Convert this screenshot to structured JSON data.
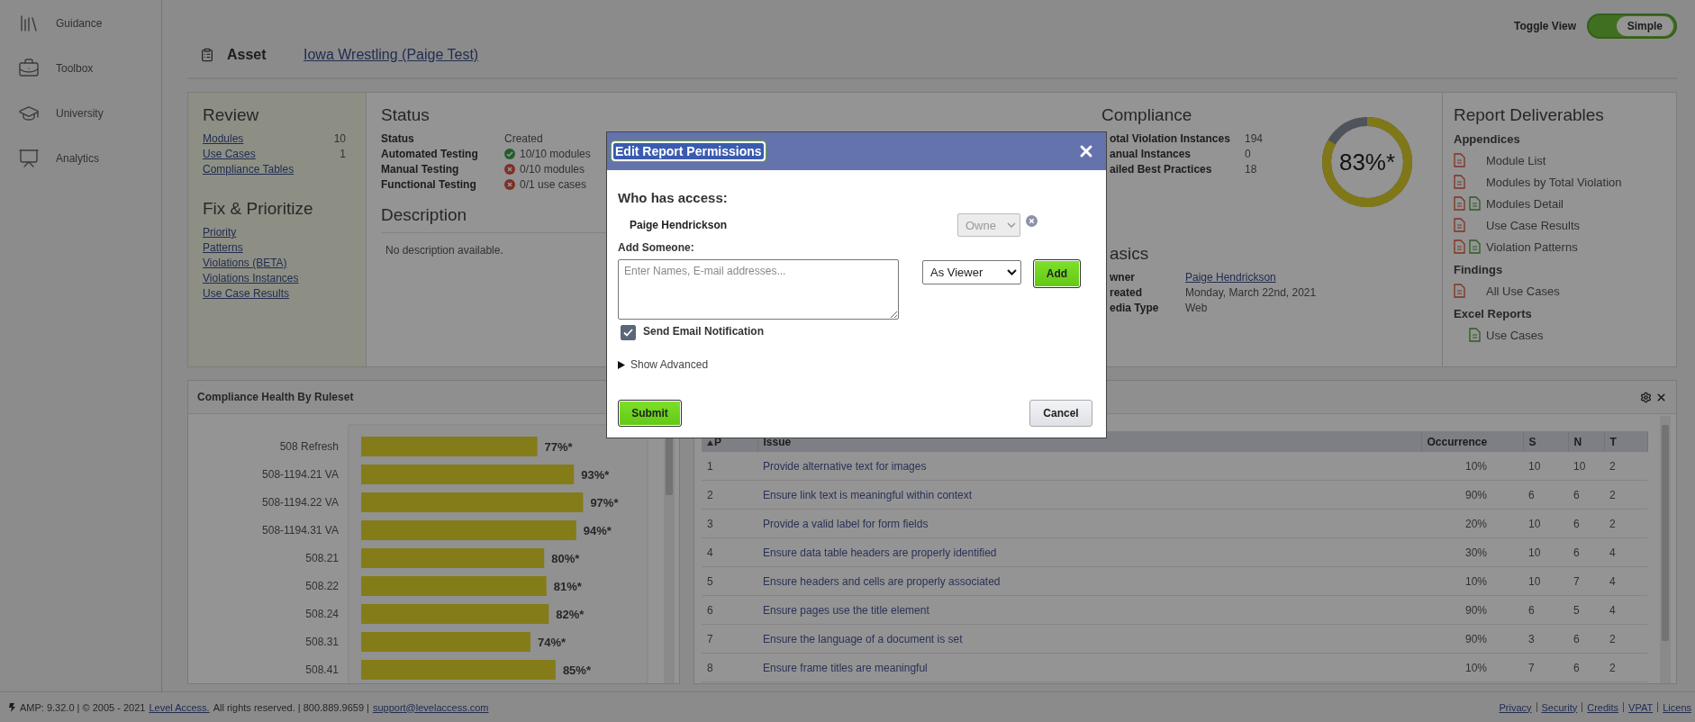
{
  "sidebar": {
    "items": [
      {
        "label": "Guidance"
      },
      {
        "label": "Toolbox"
      },
      {
        "label": "University"
      },
      {
        "label": "Analytics"
      }
    ]
  },
  "toggle_view": {
    "label": "Toggle View",
    "option": "Simple",
    "on": true
  },
  "asset": {
    "label": "Asset",
    "name": "Iowa Wrestling (Paige Test)"
  },
  "review": {
    "title": "Review",
    "links": [
      {
        "label": "Modules",
        "count": "10"
      },
      {
        "label": "Use Cases",
        "count": "1"
      },
      {
        "label": "Compliance Tables"
      }
    ]
  },
  "fix_prioritize": {
    "title": "Fix & Prioritize",
    "links": [
      "Priority",
      "Patterns",
      "Violations (BETA)",
      "Violations Instances",
      "Use Case Results"
    ]
  },
  "status": {
    "title": "Status",
    "rows": [
      {
        "label": "Status",
        "value": "Created",
        "kind": "plain"
      },
      {
        "label": "Automated Testing",
        "value": "10/10 modules",
        "kind": "pass"
      },
      {
        "label": "Manual Testing",
        "value": "0/10 modules",
        "kind": "fail"
      },
      {
        "label": "Functional Testing",
        "value": "0/1 use cases",
        "kind": "fail"
      }
    ]
  },
  "description": {
    "title": "Description",
    "text": "No description available."
  },
  "compliance": {
    "title": "Compliance",
    "rows": [
      {
        "label": "otal Violation Instances",
        "value": "194"
      },
      {
        "label": "anual Instances",
        "value": "0"
      },
      {
        "label": "ailed Best Practices",
        "value": "18"
      }
    ],
    "gauge": {
      "label": "83%*",
      "level": 0.83
    }
  },
  "basics": {
    "title": "asics",
    "rows": [
      {
        "label": "wner",
        "value": "Paige Hendrickson",
        "kind": "link"
      },
      {
        "label": "reated",
        "value": "Monday, March 22nd, 2021",
        "kind": "text"
      },
      {
        "label": "edia Type",
        "value": "Web",
        "kind": "text"
      }
    ]
  },
  "deliverables": {
    "title": "Report Deliverables",
    "groups": [
      {
        "title": "Appendices",
        "items": [
          {
            "label": "Module List",
            "pdf": true,
            "spreadsheet": false
          },
          {
            "label": "Modules by Total Violation",
            "pdf": true,
            "spreadsheet": false
          },
          {
            "label": "Modules Detail",
            "pdf": true,
            "spreadsheet": true
          },
          {
            "label": "Use Case Results",
            "pdf": true,
            "spreadsheet": false
          },
          {
            "label": "Violation Patterns",
            "pdf": true,
            "spreadsheet": true
          }
        ]
      },
      {
        "title": "Findings",
        "items": [
          {
            "label": "All Use Cases",
            "pdf": true,
            "spreadsheet": false
          }
        ]
      },
      {
        "title": "Excel Reports",
        "items": [
          {
            "label": "Use Cases",
            "pdf": false,
            "spreadsheet": true
          }
        ]
      }
    ]
  },
  "health": {
    "title": "Compliance Health By Ruleset",
    "chart_data": {
      "type": "bar",
      "orientation": "horizontal",
      "categories": [
        "508 Refresh",
        "508-1194.21 VA",
        "508-1194.22 VA",
        "508-1194.31 VA",
        "508.21",
        "508.22",
        "508.24",
        "508.31",
        "508.41"
      ],
      "values": [
        77,
        93,
        97,
        94,
        80,
        81,
        82,
        74,
        85
      ],
      "value_labels": [
        "77%*",
        "93%*",
        "97%*",
        "94%*",
        "80%*",
        "81%*",
        "82%*",
        "74%*",
        "85%*"
      ]
    }
  },
  "issues": {
    "columns": [
      {
        "label": "P",
        "sorted": true
      },
      {
        "label": "Issue",
        "sorted": false
      },
      {
        "label": "Occurrence",
        "sorted": false
      },
      {
        "label": "S",
        "sorted": false
      },
      {
        "label": "N",
        "sorted": false
      },
      {
        "label": "T",
        "sorted": false
      }
    ],
    "rows": [
      [
        "1",
        "Provide alternative text for images",
        "10%",
        "10",
        "10",
        "2"
      ],
      [
        "2",
        "Ensure link text is meaningful within context",
        "90%",
        "6",
        "6",
        "2"
      ],
      [
        "3",
        "Provide a valid label for form fields",
        "20%",
        "10",
        "6",
        "2"
      ],
      [
        "4",
        "Ensure data table headers are properly identified",
        "30%",
        "10",
        "6",
        "4"
      ],
      [
        "5",
        "Ensure headers and cells are properly associated",
        "10%",
        "10",
        "7",
        "4"
      ],
      [
        "6",
        "Ensure pages use the title element",
        "90%",
        "6",
        "5",
        "4"
      ],
      [
        "7",
        "Ensure the language of a document is set",
        "90%",
        "3",
        "6",
        "2"
      ],
      [
        "8",
        "Ensure frame titles are meaningful",
        "10%",
        "7",
        "6",
        "2"
      ]
    ]
  },
  "footer": {
    "version": "AMP: 9.32.0 | © 2005 - 2021",
    "company_link": "Level Access.",
    "rights": "All rights reserved. | 800.889.9659 |",
    "email_link": "support@levelaccess.com",
    "links": [
      "Privacy",
      "Security",
      "Credits",
      "VPAT",
      "Licens"
    ]
  },
  "modal": {
    "title": "Edit Report Permissions",
    "access_heading": "Who has access:",
    "people": [
      {
        "name": "Paige Hendrickson",
        "role": "Owne",
        "disabled": true
      }
    ],
    "add_label": "Add Someone:",
    "placeholder": "Enter Names, E-mail addresses...",
    "role_select": "As Viewer",
    "add_button": "Add",
    "notify": {
      "label": "Send Email Notification",
      "checked": true
    },
    "advanced": {
      "label": "Show Advanced",
      "expanded": false
    },
    "submit": "Submit",
    "cancel": "Cancel"
  }
}
